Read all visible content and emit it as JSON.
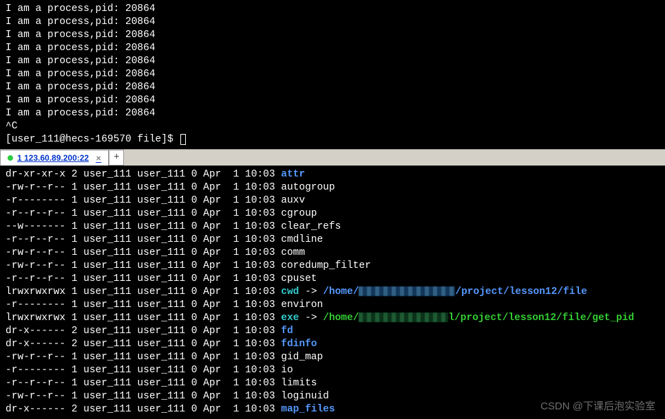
{
  "top": {
    "process_prefix": "I am a process,pid:",
    "pid": "20864",
    "repeat": 9,
    "interrupt": "^C",
    "prompt": "[user_111@hecs-169570 file]$ "
  },
  "tab": {
    "label": "1 123.60.89.200:22",
    "close": "×",
    "add": "+"
  },
  "ls": {
    "date_prefix_1": "1 user_111 user_111 0 Apr  1 10:03",
    "date_prefix_2": "2 user_111 user_111 0 Apr  1 10:03",
    "rows": [
      {
        "perm": "dr-xr-xr-x",
        "n": "2",
        "name": "attr",
        "color": "blue"
      },
      {
        "perm": "-rw-r--r--",
        "n": "1",
        "name": "autogroup",
        "color": "white"
      },
      {
        "perm": "-r--------",
        "n": "1",
        "name": "auxv",
        "color": "white"
      },
      {
        "perm": "-r--r--r--",
        "n": "1",
        "name": "cgroup",
        "color": "white"
      },
      {
        "perm": "--w-------",
        "n": "1",
        "name": "clear_refs",
        "color": "white"
      },
      {
        "perm": "-r--r--r--",
        "n": "1",
        "name": "cmdline",
        "color": "white"
      },
      {
        "perm": "-rw-r--r--",
        "n": "1",
        "name": "comm",
        "color": "white"
      },
      {
        "perm": "-rw-r--r--",
        "n": "1",
        "name": "coredump_filter",
        "color": "white"
      },
      {
        "perm": "-r--r--r--",
        "n": "1",
        "name": "cpuset",
        "color": "white"
      },
      {
        "perm": "lrwxrwxrwx",
        "n": "1",
        "name": "cwd",
        "color": "cyan",
        "link": true,
        "target_prefix": "/home/",
        "target_suffix": "/project/lesson12/file",
        "target_color": "blue",
        "obscure": "obscured"
      },
      {
        "perm": "-r--------",
        "n": "1",
        "name": "environ",
        "color": "white"
      },
      {
        "perm": "lrwxrwxrwx",
        "n": "1",
        "name": "exe",
        "color": "cyan",
        "link": true,
        "target_prefix": "/home/",
        "target_suffix": "l/project/lesson12/file/get_pid",
        "target_color": "green",
        "obscure": "obscured2"
      },
      {
        "perm": "dr-x------",
        "n": "2",
        "name": "fd",
        "color": "blue"
      },
      {
        "perm": "dr-x------",
        "n": "2",
        "name": "fdinfo",
        "color": "blue"
      },
      {
        "perm": "-rw-r--r--",
        "n": "1",
        "name": "gid_map",
        "color": "white"
      },
      {
        "perm": "-r--------",
        "n": "1",
        "name": "io",
        "color": "white"
      },
      {
        "perm": "-r--r--r--",
        "n": "1",
        "name": "limits",
        "color": "white"
      },
      {
        "perm": "-rw-r--r--",
        "n": "1",
        "name": "loginuid",
        "color": "white"
      },
      {
        "perm": "dr-x------",
        "n": "2",
        "name": "map_files",
        "color": "blue"
      }
    ],
    "arrow": " -> "
  },
  "watermark": "CSDN @下课后泡实验室"
}
